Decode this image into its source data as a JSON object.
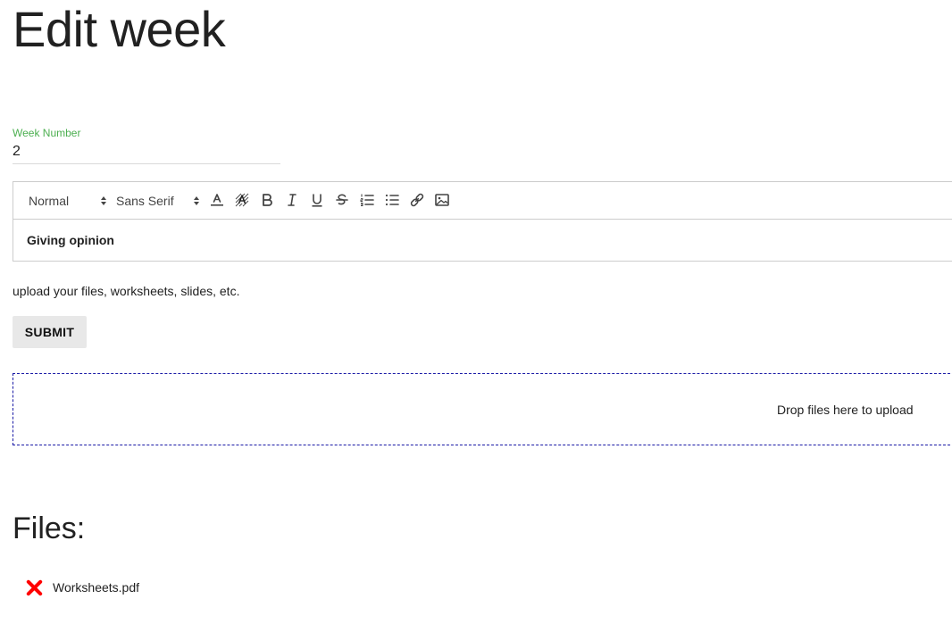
{
  "page": {
    "title": "Edit week"
  },
  "week_field": {
    "label": "Week Number",
    "value": "2"
  },
  "editor": {
    "toolbar": {
      "size_picker": "Normal",
      "font_picker": "Sans Serif",
      "buttons": [
        "text-color-icon",
        "background-color-icon",
        "bold-icon",
        "italic-icon",
        "underline-icon",
        "strikethrough-icon",
        "ordered-list-icon",
        "bullet-list-icon",
        "link-icon",
        "image-icon"
      ]
    },
    "content": "Giving opinion"
  },
  "upload": {
    "hint": "upload your files, worksheets, slides, etc.",
    "submit_label": "SUBMIT",
    "dropzone_text": "Drop files here to upload"
  },
  "files": {
    "heading": "Files:",
    "items": [
      {
        "name": "Worksheets.pdf",
        "delete_icon": "delete-x-icon"
      }
    ]
  },
  "colors": {
    "label_accent": "#4caf50",
    "dropzone_border": "#1a1aa6",
    "delete_icon": "#ff0000",
    "button_bg": "#e8e8e8"
  }
}
